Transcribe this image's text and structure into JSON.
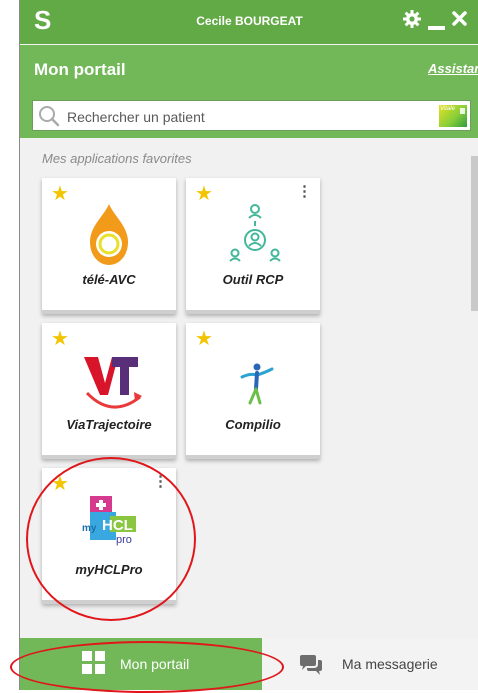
{
  "window": {
    "logo": "S",
    "user_name": "Cecile BOURGEAT",
    "controls": {
      "settings": "gear-icon",
      "minimize": "minus-icon",
      "close": "close-icon"
    }
  },
  "header": {
    "title": "Mon portail",
    "assistance_link": "Assistance"
  },
  "search": {
    "placeholder": "Rechercher un patient",
    "vitale_card_label": "Vitale"
  },
  "favorites": {
    "section_title": "Mes applications favorites",
    "apps": [
      {
        "label": "télé-AVC",
        "icon": "tele-avc-drop-icon",
        "favorite": true,
        "has_menu": false
      },
      {
        "label": "Outil RCP",
        "icon": "rcp-people-network-icon",
        "favorite": true,
        "has_menu": true
      },
      {
        "label": "ViaTrajectoire",
        "icon": "viatrajectoire-logo-icon",
        "favorite": true,
        "has_menu": false
      },
      {
        "label": "Compilio",
        "icon": "compilio-figure-icon",
        "favorite": true,
        "has_menu": false
      },
      {
        "label": "myHCLPro",
        "icon": "myhclpro-logo-icon",
        "favorite": true,
        "has_menu": true
      }
    ]
  },
  "myhcl_logo": {
    "my": "my",
    "hcl": "HCL",
    "pro": "pro"
  },
  "bottom_nav": {
    "portal_label": "Mon portail",
    "messaging_label": "Ma messagerie"
  },
  "colors": {
    "green_dark": "#62aa46",
    "green": "#72b758",
    "star": "#f2c500",
    "annotation_red": "#e0161b"
  }
}
